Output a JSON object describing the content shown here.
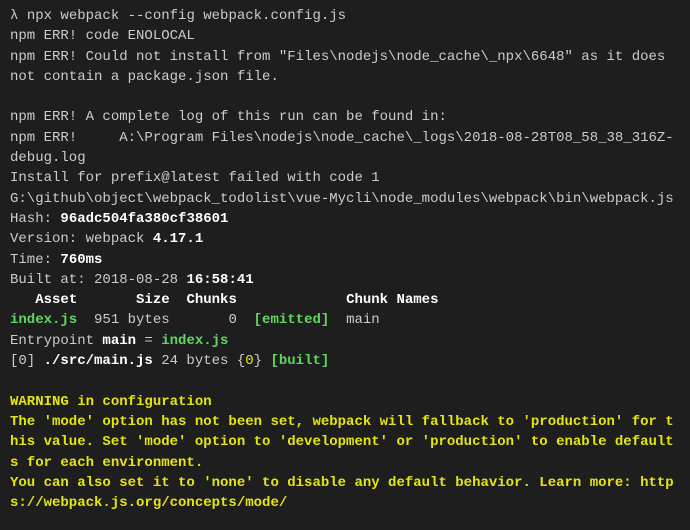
{
  "lines": [
    {
      "spans": [
        {
          "class": "prompt",
          "text": "λ "
        },
        {
          "class": "",
          "text": "npx webpack --config webpack.config.js"
        }
      ]
    },
    {
      "spans": [
        {
          "class": "",
          "text": "npm ERR! code ENOLOCAL"
        }
      ]
    },
    {
      "spans": [
        {
          "class": "",
          "text": "npm ERR! Could not install from \"Files\\nodejs\\node_cache\\_npx\\6648\" as it does not contain a package.json file."
        }
      ]
    },
    {
      "spans": [
        {
          "class": "",
          "text": " "
        }
      ]
    },
    {
      "spans": [
        {
          "class": "",
          "text": "npm ERR! A complete log of this run can be found in:"
        }
      ]
    },
    {
      "spans": [
        {
          "class": "",
          "text": "npm ERR!     A:\\Program Files\\nodejs\\node_cache\\_logs\\2018-08-28T08_58_38_316Z-debug.log"
        }
      ]
    },
    {
      "spans": [
        {
          "class": "",
          "text": "Install for prefix@latest failed with code 1"
        }
      ]
    },
    {
      "spans": [
        {
          "class": "",
          "text": "G:\\github\\object\\webpack_todolist\\vue-Mycli\\node_modules\\webpack\\bin\\webpack.js"
        }
      ]
    },
    {
      "spans": [
        {
          "class": "",
          "text": "Hash: "
        },
        {
          "class": "white bold",
          "text": "96adc504fa380cf38601"
        }
      ]
    },
    {
      "spans": [
        {
          "class": "",
          "text": "Version: webpack "
        },
        {
          "class": "white bold",
          "text": "4.17.1"
        }
      ]
    },
    {
      "spans": [
        {
          "class": "",
          "text": "Time: "
        },
        {
          "class": "white bold",
          "text": "760ms"
        }
      ]
    },
    {
      "spans": [
        {
          "class": "",
          "text": "Built at: 2018-08-28 "
        },
        {
          "class": "white bold",
          "text": "16:58:41"
        }
      ]
    },
    {
      "spans": [
        {
          "class": "white bold",
          "text": "   Asset       Size  Chunks             Chunk Names"
        }
      ]
    },
    {
      "spans": [
        {
          "class": "green bold",
          "text": "index.js"
        },
        {
          "class": "",
          "text": "  951 bytes       0  "
        },
        {
          "class": "green bold",
          "text": "[emitted]"
        },
        {
          "class": "",
          "text": "  main"
        }
      ]
    },
    {
      "spans": [
        {
          "class": "",
          "text": "Entrypoint "
        },
        {
          "class": "white bold",
          "text": "main"
        },
        {
          "class": "",
          "text": " = "
        },
        {
          "class": "green bold",
          "text": "index.js"
        }
      ]
    },
    {
      "spans": [
        {
          "class": "",
          "text": "[0] "
        },
        {
          "class": "white bold",
          "text": "./src/main.js"
        },
        {
          "class": "",
          "text": " 24 bytes {"
        },
        {
          "class": "yellow",
          "text": "0"
        },
        {
          "class": "",
          "text": "} "
        },
        {
          "class": "green bold",
          "text": "[built]"
        }
      ]
    },
    {
      "spans": [
        {
          "class": "",
          "text": " "
        }
      ]
    },
    {
      "spans": [
        {
          "class": "yellow bold",
          "text": "WARNING in configuration"
        }
      ]
    },
    {
      "spans": [
        {
          "class": "yellow bold",
          "text": "The 'mode' option has not been set, webpack will fallback to 'production' for this value. Set 'mode' option to 'development' or 'production' to enable defaults for each environment."
        }
      ]
    },
    {
      "spans": [
        {
          "class": "yellow bold",
          "text": "You can also set it to 'none' to disable any default behavior. Learn more: https://webpack.js.org/concepts/mode/"
        }
      ]
    }
  ]
}
